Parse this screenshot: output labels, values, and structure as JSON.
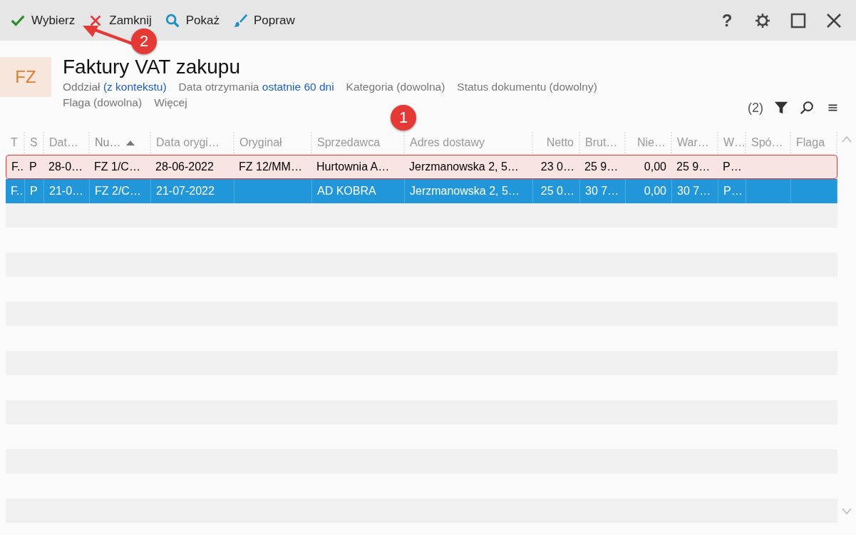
{
  "toolbar": {
    "actions": [
      {
        "kind": "check",
        "label": "Wybierz"
      },
      {
        "kind": "cross",
        "label": "Zamknij"
      },
      {
        "kind": "search",
        "label": "Pokaż"
      },
      {
        "kind": "brush",
        "label": "Popraw"
      }
    ],
    "window_buttons": [
      {
        "kind": "help",
        "label": "?"
      },
      {
        "kind": "settings"
      },
      {
        "kind": "maximize"
      },
      {
        "kind": "close"
      }
    ]
  },
  "header": {
    "badge": "FZ",
    "title": "Faktury VAT zakupu",
    "filters": [
      [
        {
          "label": "Oddział",
          "value": "(z kontekstu)",
          "active": true
        },
        {
          "label": "Data otrzymania",
          "value": "ostatnie 60 dni",
          "active": true
        },
        {
          "label": "Kategoria",
          "value": "(dowolna)",
          "active": false
        },
        {
          "label": "Status dokumentu",
          "value": "(dowolny)",
          "active": false
        }
      ],
      [
        {
          "label": "Flaga",
          "value": "(dowolna)",
          "active": false
        },
        {
          "label": "Więcej"
        }
      ]
    ],
    "count": "(2)"
  },
  "table": {
    "columns": [
      {
        "label": "T",
        "sorted": false
      },
      {
        "label": "S",
        "sorted": false
      },
      {
        "label": "Dat…",
        "sorted": false
      },
      {
        "label": "Nu…",
        "sorted": true
      },
      {
        "label": "Data orygi…",
        "sorted": false
      },
      {
        "label": "Oryginał",
        "sorted": false
      },
      {
        "label": "Sprzedawca",
        "sorted": false
      },
      {
        "label": "Adres dostawy",
        "sorted": false
      },
      {
        "label": "Netto",
        "sorted": false
      },
      {
        "label": "Brut…",
        "sorted": false
      },
      {
        "label": "Nie…",
        "sorted": false
      },
      {
        "label": "War…",
        "sorted": false
      },
      {
        "label": "W…",
        "sorted": false
      },
      {
        "label": "Spó…",
        "sorted": false
      },
      {
        "label": "Flaga",
        "sorted": false
      }
    ],
    "rows": [
      {
        "selected": false,
        "marked": true,
        "cells": [
          "F..",
          "P",
          "28-0…",
          "FZ 1/C…",
          "28-06-2022",
          "FZ 12/MM…",
          "Hurtownia A…",
          "Jerzmanowska 2, 5…",
          "23 0…",
          "25 9…",
          "0,00",
          "25 9…",
          "P…",
          "",
          ""
        ]
      },
      {
        "selected": true,
        "marked": false,
        "cells": [
          "F..",
          "P",
          "21-0…",
          "FZ 2/C…",
          "21-07-2022",
          "",
          "AD KOBRA",
          "Jerzmanowska 2, 5…",
          "25 0…",
          "30 7…",
          "0,00",
          "30 7…",
          "P…",
          "",
          ""
        ]
      }
    ]
  },
  "annotations": [
    {
      "number": "1"
    },
    {
      "number": "2"
    }
  ]
}
